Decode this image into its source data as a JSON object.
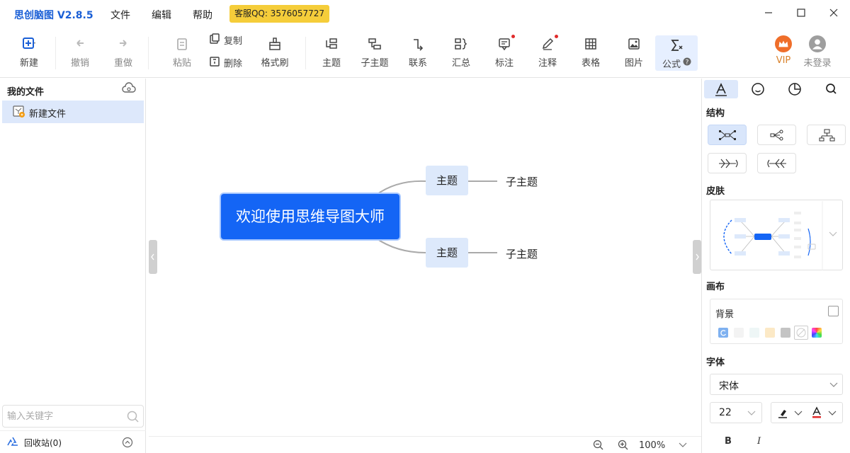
{
  "app": {
    "title": "思创脑图 V2.8.5",
    "menu": [
      "文件",
      "编辑",
      "帮助"
    ],
    "support_badge": "客服QQ: 3576057727"
  },
  "toolbar": {
    "new": "新建",
    "undo": "撤销",
    "redo": "重做",
    "paste": "粘贴",
    "copy": "复制",
    "delete": "删除",
    "format_painter": "格式刷",
    "topic": "主题",
    "subtopic": "子主题",
    "relation": "联系",
    "summary": "汇总",
    "marker": "标注",
    "note": "注释",
    "table": "表格",
    "image": "图片",
    "formula": "公式",
    "vip": "VIP",
    "login": "未登录"
  },
  "left_panel": {
    "title": "我的文件",
    "files": [
      "新建文件"
    ],
    "search_placeholder": "输入关键字",
    "recycle": "回收站(0)"
  },
  "mindmap": {
    "root": "欢迎使用思维导图大师",
    "topics": [
      {
        "label": "主题",
        "sub": "子主题"
      },
      {
        "label": "主题",
        "sub": "子主题"
      }
    ]
  },
  "status": {
    "zoom": "100%"
  },
  "right_panel": {
    "structure": "结构",
    "skin": "皮肤",
    "canvas": "画布",
    "background": "背景",
    "font": "字体",
    "font_family": "宋体",
    "font_size": "22",
    "bold": "B",
    "italic": "I",
    "colors": {
      "accent": "#1465f5",
      "topic_fill": "#dde9fb",
      "badge": "#f5cd3a"
    }
  }
}
